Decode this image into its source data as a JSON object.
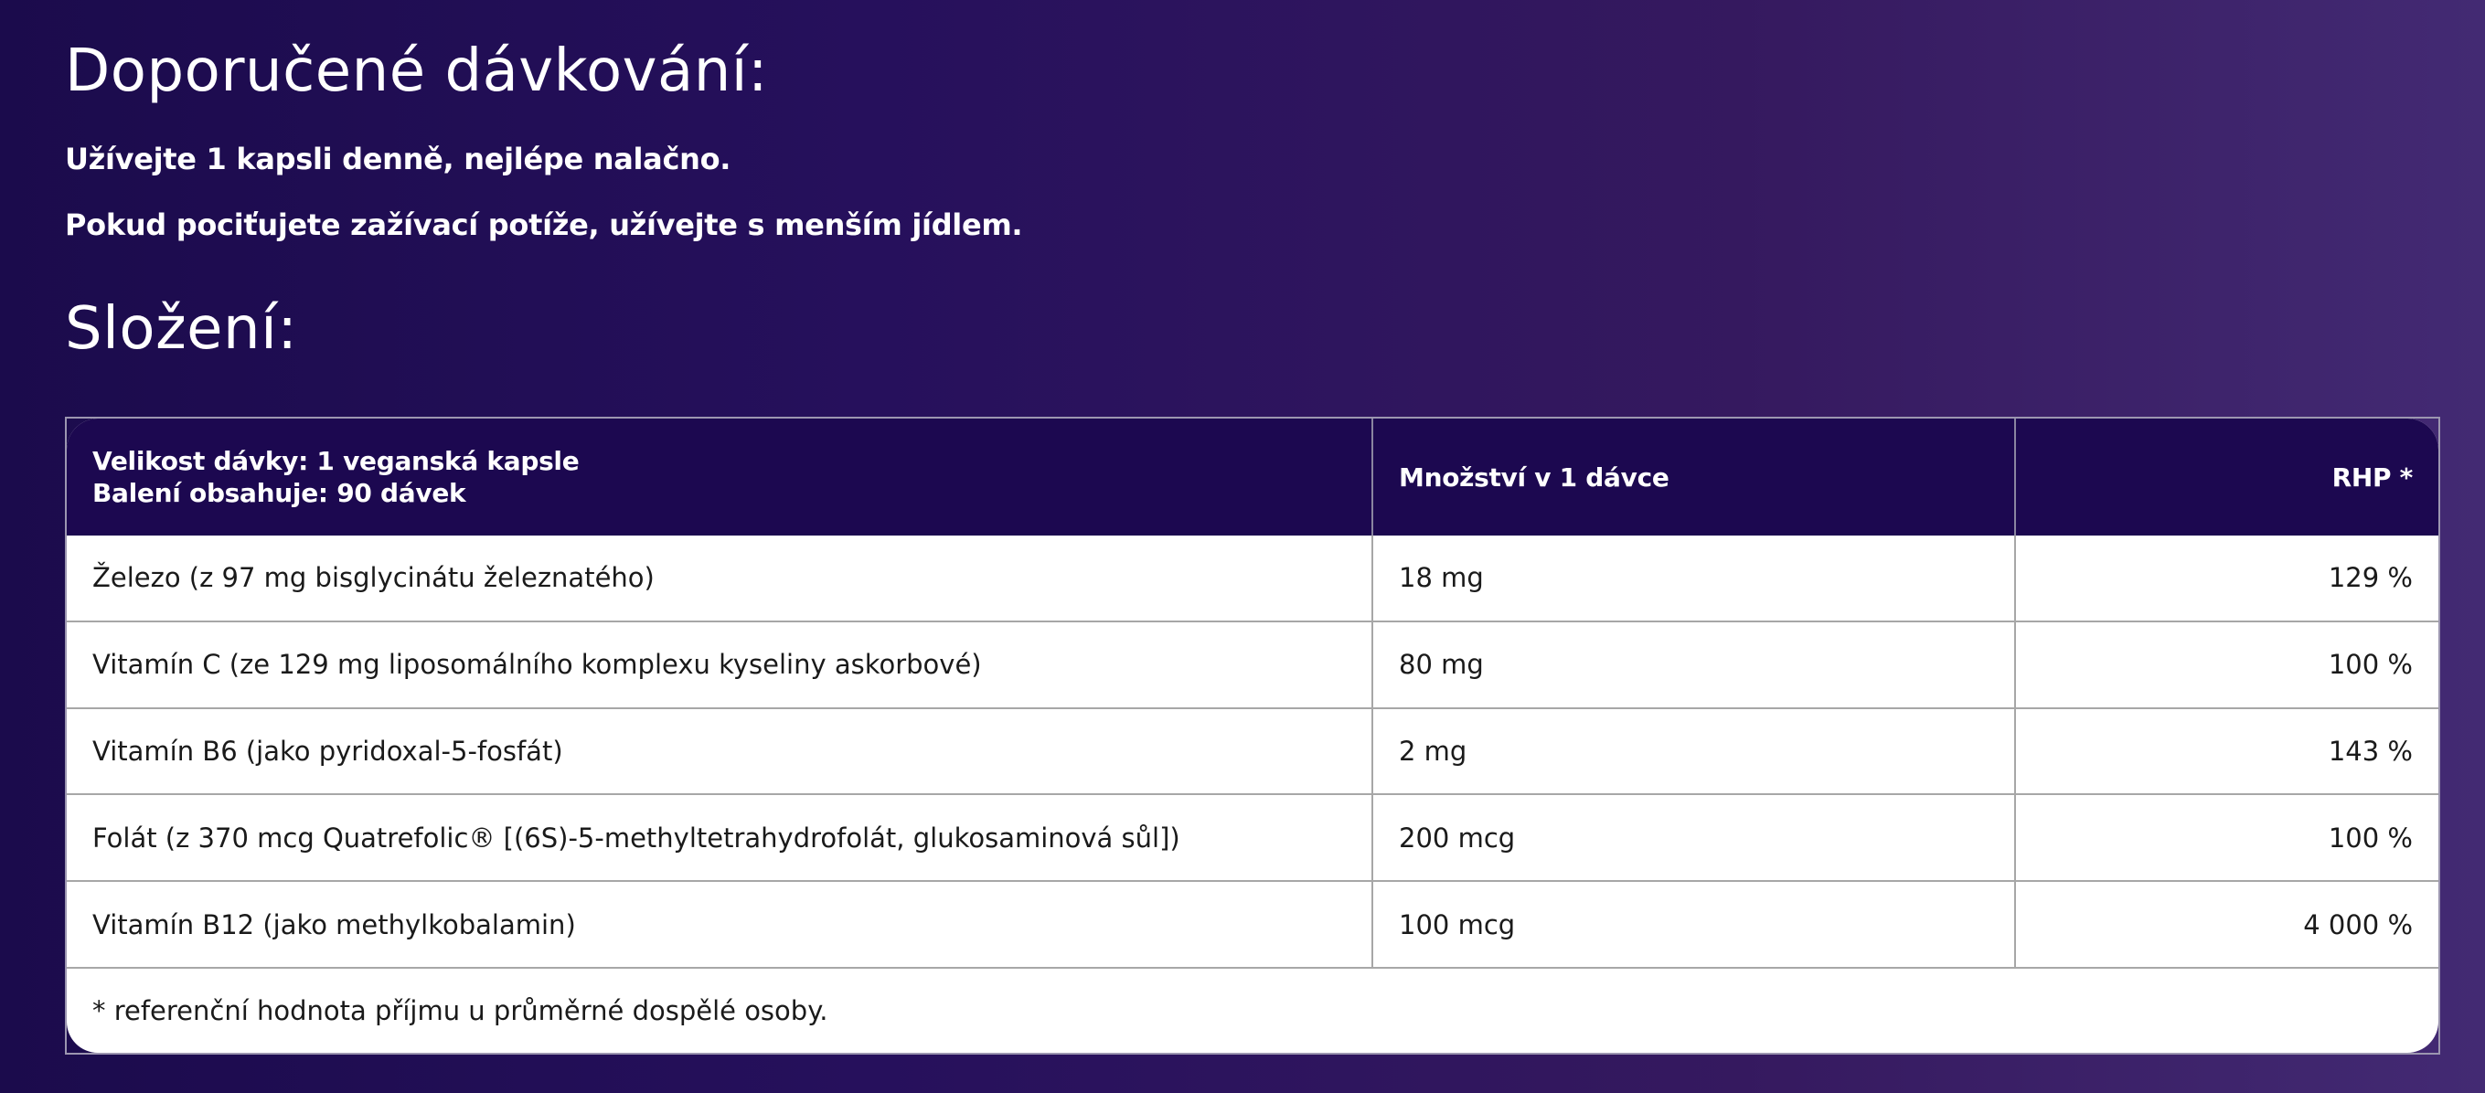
{
  "dosage": {
    "title": "Doporučené dávkování:",
    "line1": "Užívejte 1 kapsli denně, nejlépe nalačno.",
    "line2": "Pokud pociťujete zažívací potíže, užívejte s menším jídlem."
  },
  "composition": {
    "title": "Složení:",
    "header": {
      "col1_line1": "Velikost dávky: 1 veganská kapsle",
      "col1_line2": "Balení obsahuje: 90 dávek",
      "col2": "Množství v 1 dávce",
      "col3": "RHP *"
    },
    "rows": [
      {
        "name": "Železo (z 97 mg bisglycinátu železnatého)",
        "amount": "18 mg",
        "rhp": "129 %"
      },
      {
        "name": "Vitamín C (ze 129 mg liposomálního komplexu kyseliny askorbové)",
        "amount": "80 mg",
        "rhp": "100 %"
      },
      {
        "name": "Vitamín B6 (jako pyridoxal-5-fosfát)",
        "amount": "2 mg",
        "rhp": "143 %"
      },
      {
        "name": "Folát (z 370 mcg Quatrefolic® [(6S)-5-methyltetrahydrofolát, glukosaminová sůl])",
        "amount": "200 mcg",
        "rhp": "100 %"
      },
      {
        "name": "Vitamín B12 (jako methylkobalamin)",
        "amount": "100 mcg",
        "rhp": "4 000 %"
      }
    ],
    "footnote": "* referenční hodnota příjmu u průměrné dospělé osoby."
  }
}
